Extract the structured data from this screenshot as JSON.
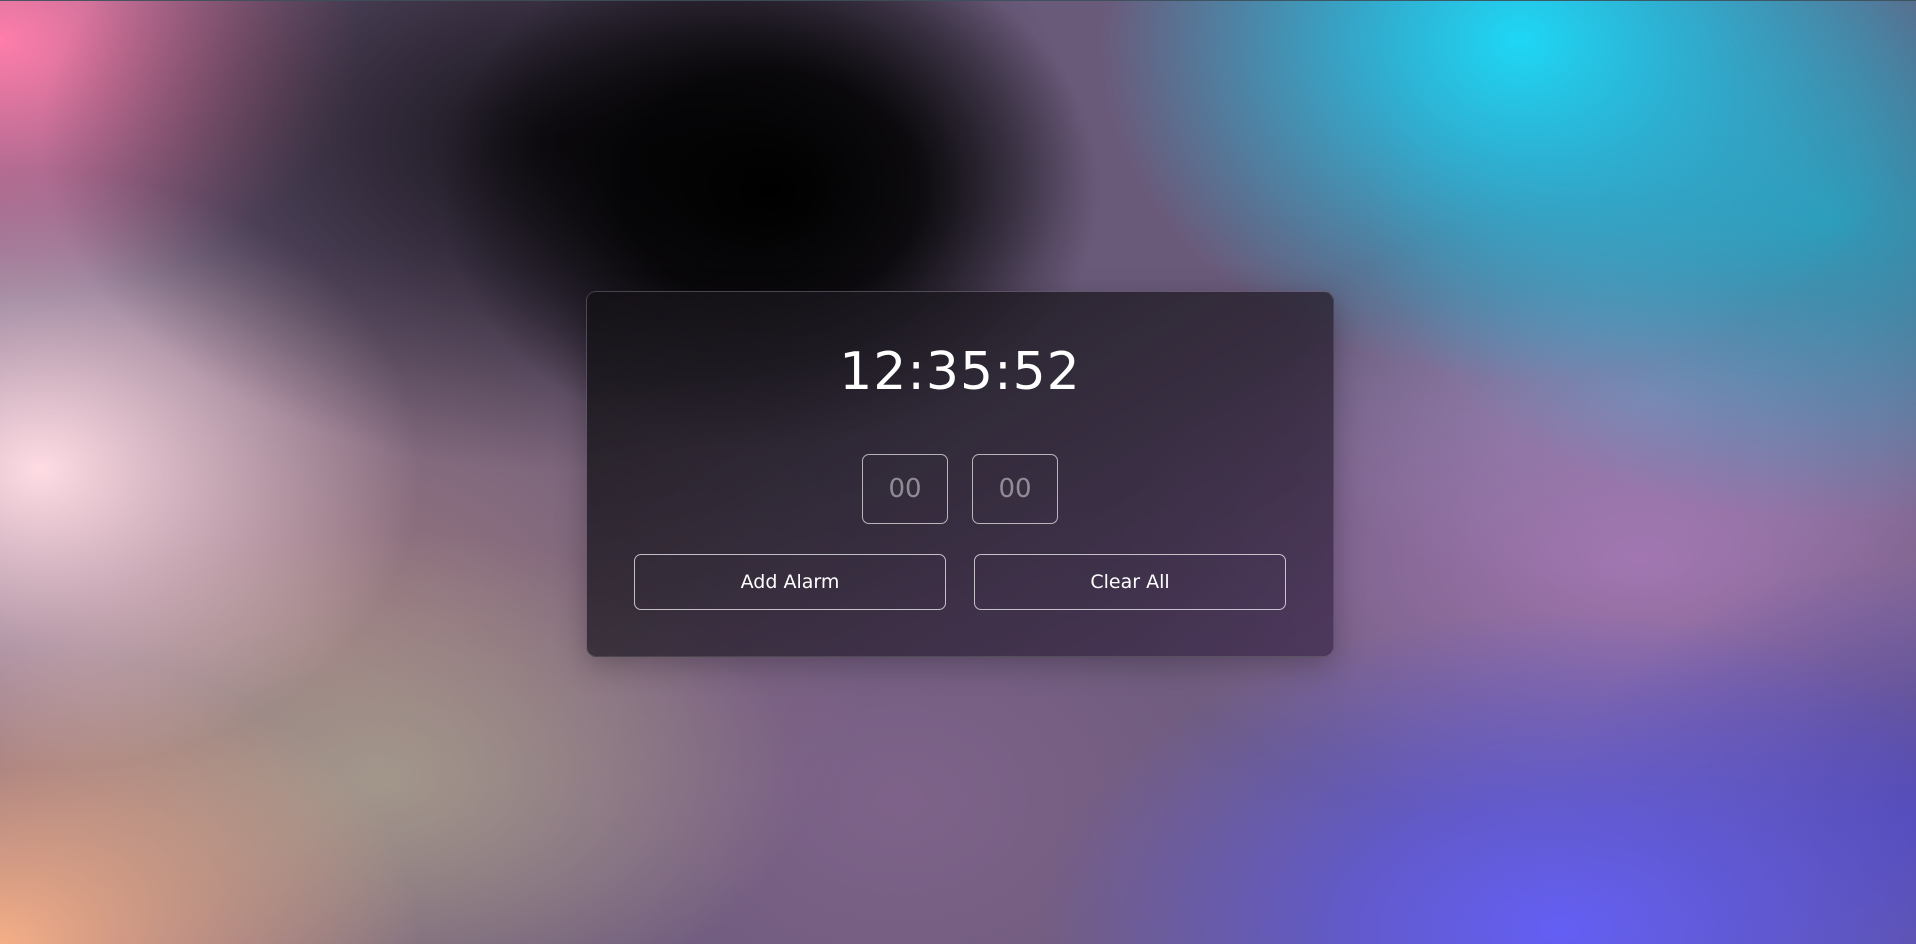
{
  "clock": {
    "time": "12:35:52"
  },
  "alarm_inputs": {
    "hour_placeholder": "00",
    "minute_placeholder": "00"
  },
  "buttons": {
    "add_alarm_label": "Add Alarm",
    "clear_all_label": "Clear All"
  }
}
